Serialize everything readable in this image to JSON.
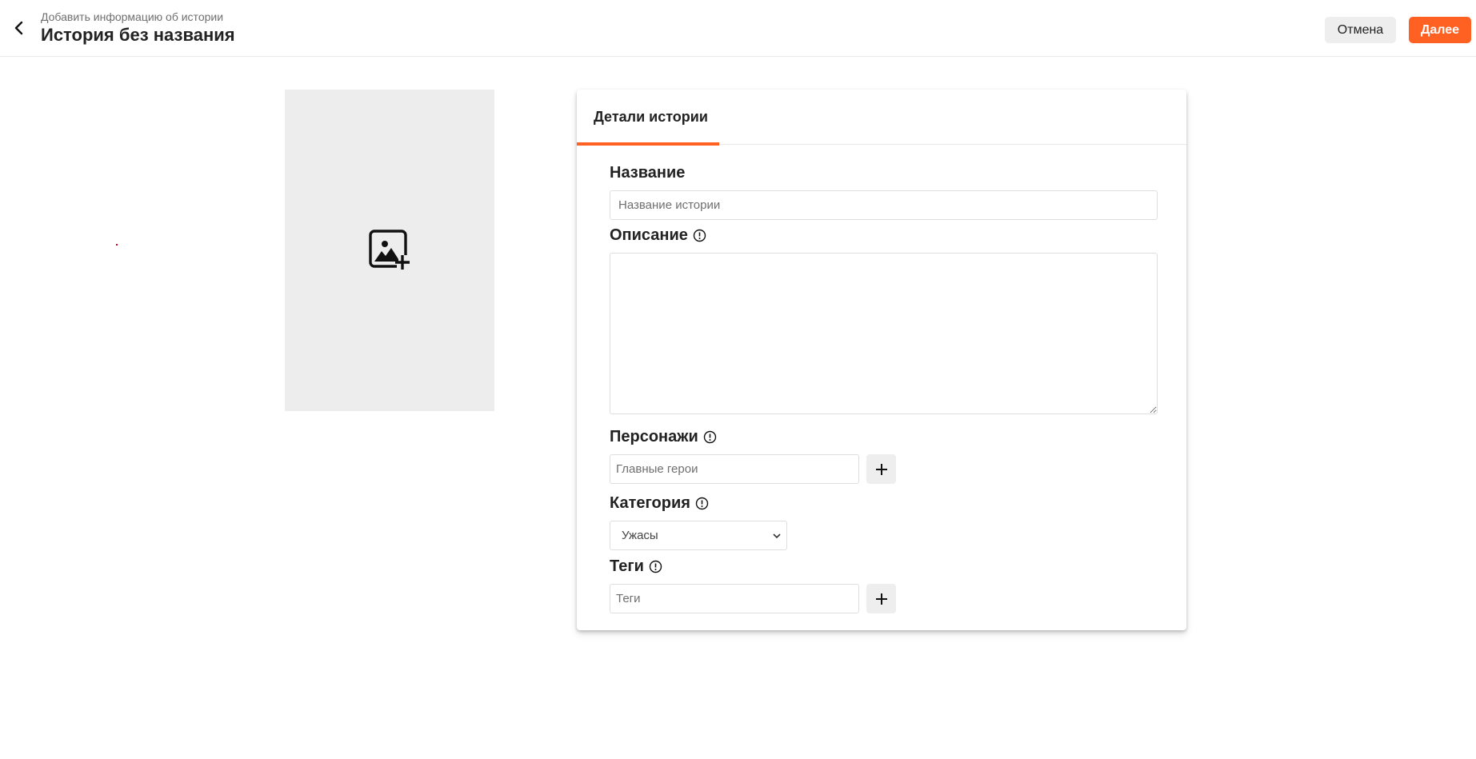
{
  "header": {
    "subtitle": "Добавить информацию об истории",
    "title": "История без названия",
    "back_icon": "chevron-left-icon",
    "cancel_label": "Отмена",
    "next_label": "Далее"
  },
  "colors": {
    "accent": "#ff6122",
    "cover_bg": "#ededed",
    "button_gray": "#eeeeee"
  },
  "cover": {
    "icon": "add-image-icon"
  },
  "card": {
    "tab_label": "Детали истории",
    "fields": {
      "title": {
        "label": "Название",
        "placeholder": "Название истории",
        "value": ""
      },
      "description": {
        "label": "Описание",
        "info_icon": "info-icon",
        "value": ""
      },
      "characters": {
        "label": "Персонажи",
        "info_icon": "info-icon",
        "placeholder": "Главные герои",
        "add_icon": "plus-icon"
      },
      "category": {
        "label": "Категория",
        "info_icon": "info-icon",
        "selected": "Ужасы"
      },
      "tags": {
        "label": "Теги",
        "info_icon": "info-icon",
        "placeholder": "Теги",
        "add_icon": "plus-icon"
      }
    }
  }
}
